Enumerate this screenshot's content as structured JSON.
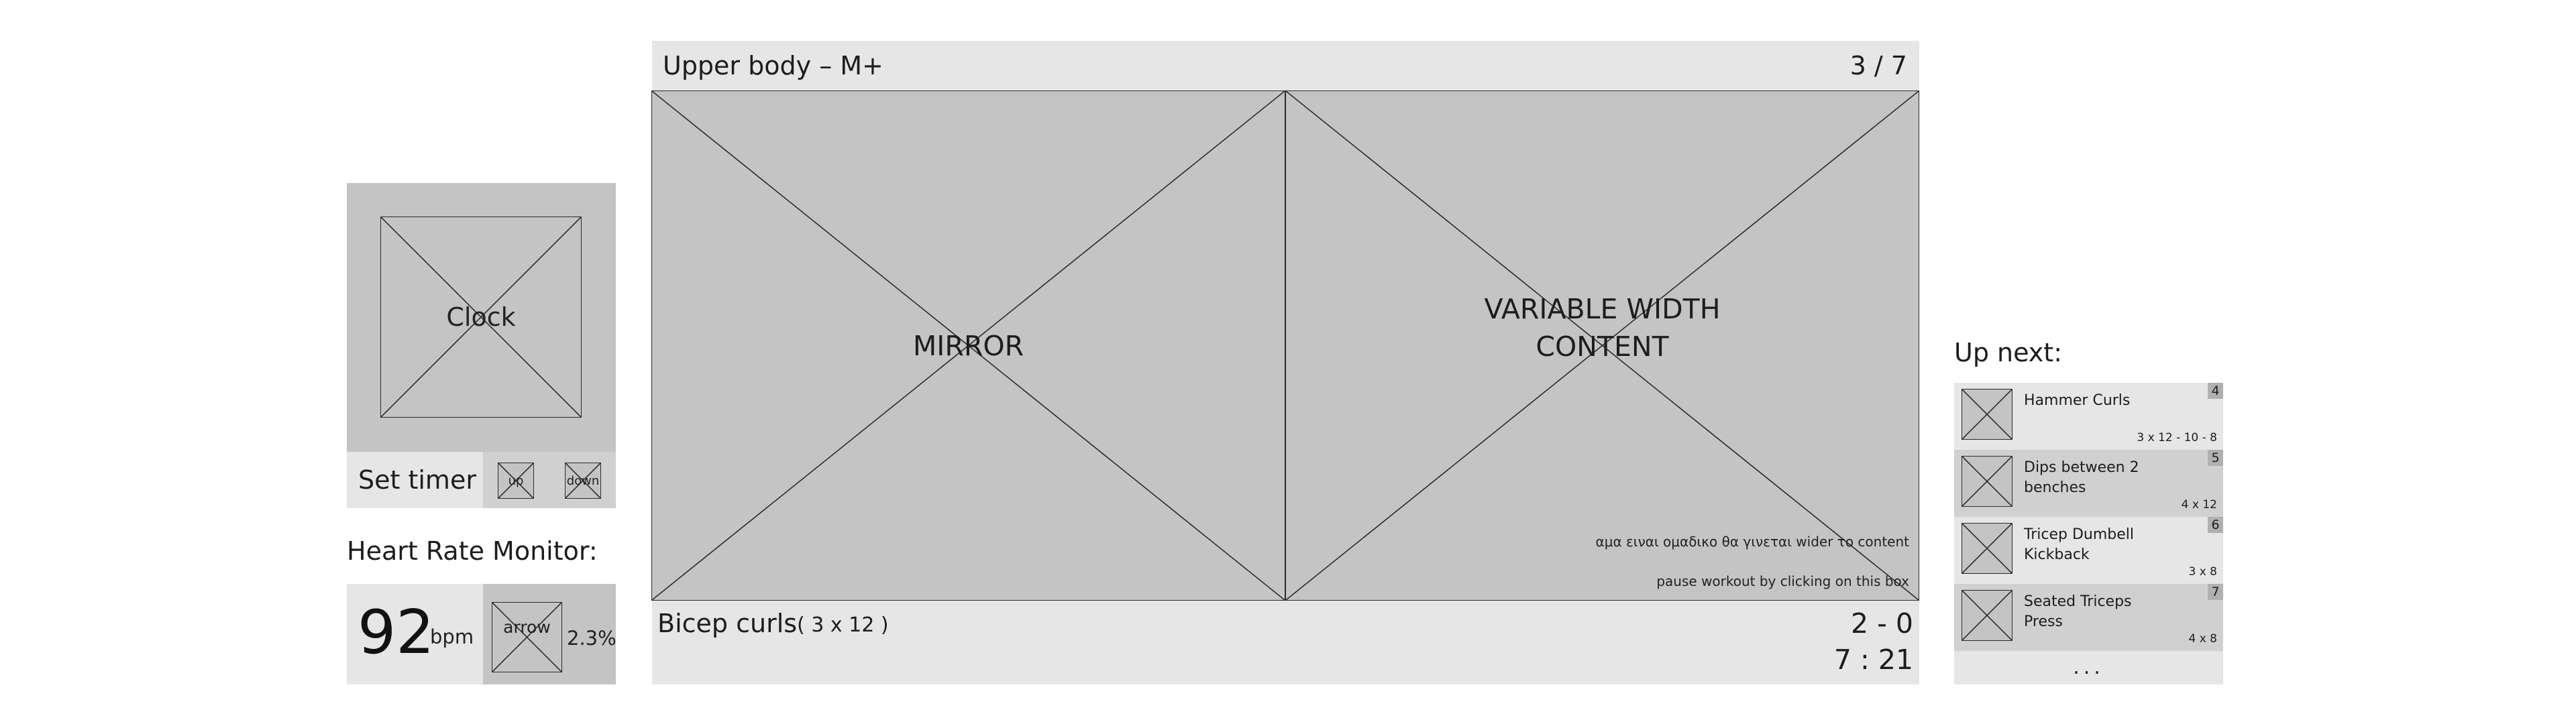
{
  "clock": {
    "label": "Clock"
  },
  "timer": {
    "label": "Set timer",
    "up_label": "up",
    "down_label": "down"
  },
  "heart_rate": {
    "title": "Heart Rate Monitor:",
    "value": "92",
    "unit": "bpm",
    "trend_label": "arrow",
    "trend_percent": "2.3%"
  },
  "workout": {
    "title": "Upper body – M+",
    "progress": "3 / 7"
  },
  "mirror": {
    "label": "MIRROR"
  },
  "variable_content": {
    "label": "VARIABLE WIDTH CONTENT",
    "note_greek": "αμα ειναι ομαδικο θα γινεται wider το content",
    "note_pause": "pause workout by clicking on this box"
  },
  "current_exercise": {
    "name": "Bicep curls",
    "sets": "( 3 x 12 )",
    "score": "2 - 0",
    "time": "7 : 21"
  },
  "up_next": {
    "title": "Up next:",
    "items": [
      {
        "index": "4",
        "name": "Hammer Curls",
        "sets": "3 x 12 - 10 - 8"
      },
      {
        "index": "5",
        "name": "Dips between 2 benches",
        "sets": "4 x 12"
      },
      {
        "index": "6",
        "name": "Tricep Dumbell Kickback",
        "sets": "3 x 8"
      },
      {
        "index": "7",
        "name": "Seated Triceps Press",
        "sets": "4 x 8"
      }
    ],
    "more": "..."
  }
}
